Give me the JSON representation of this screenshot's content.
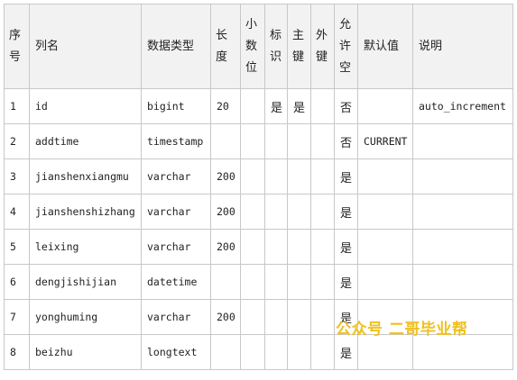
{
  "table": {
    "headers": [
      "序号",
      "列名",
      "数据类型",
      "长度",
      "小数位",
      "标识",
      "主键",
      "外键",
      "允许空",
      "默认值",
      "说明"
    ],
    "rows": [
      [
        "1",
        "id",
        "bigint",
        "20",
        "",
        "是",
        "是",
        "",
        "否",
        "",
        "auto_increment"
      ],
      [
        "2",
        "addtime",
        "timestamp",
        "",
        "",
        "",
        "",
        "",
        "否",
        "CURRENT",
        ""
      ],
      [
        "3",
        "jianshenxiangmu",
        "varchar",
        "200",
        "",
        "",
        "",
        "",
        "是",
        "",
        ""
      ],
      [
        "4",
        "jianshenshizhang",
        "varchar",
        "200",
        "",
        "",
        "",
        "",
        "是",
        "",
        ""
      ],
      [
        "5",
        "leixing",
        "varchar",
        "200",
        "",
        "",
        "",
        "",
        "是",
        "",
        ""
      ],
      [
        "6",
        "dengjishijian",
        "datetime",
        "",
        "",
        "",
        "",
        "",
        "是",
        "",
        ""
      ],
      [
        "7",
        "yonghuming",
        "varchar",
        "200",
        "",
        "",
        "",
        "",
        "是",
        "",
        ""
      ],
      [
        "8",
        "beizhu",
        "longtext",
        "",
        "",
        "",
        "",
        "",
        "是",
        "",
        ""
      ]
    ]
  },
  "watermark": "公众号 二哥毕业帮"
}
